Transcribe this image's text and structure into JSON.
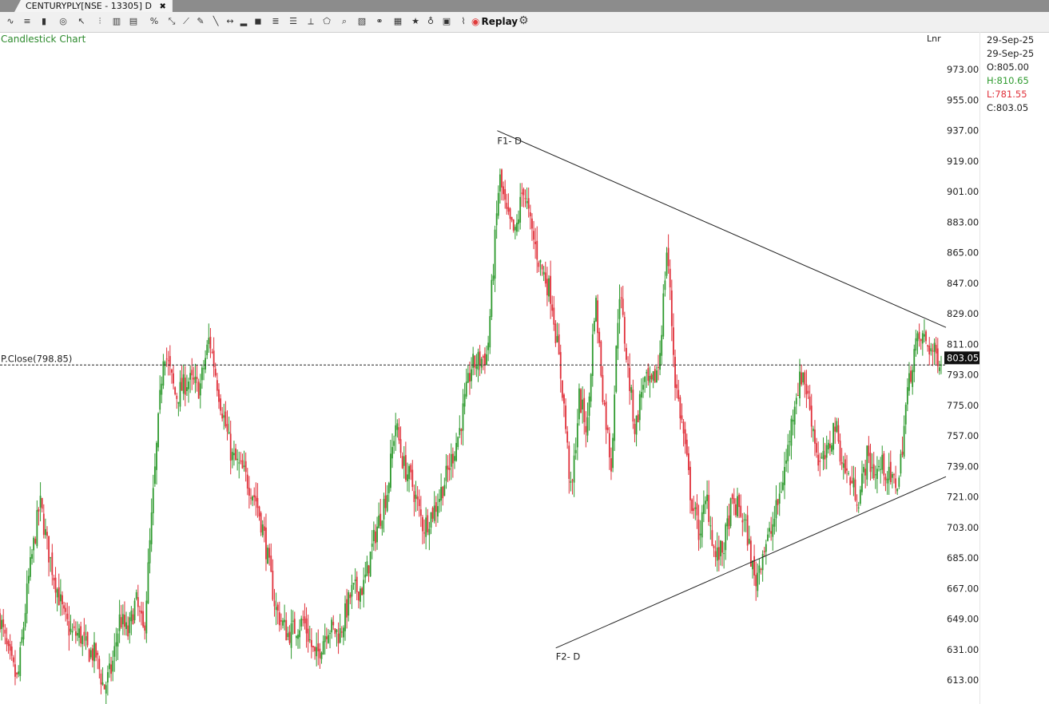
{
  "tab": {
    "title": "CENTURYPLY[NSE - 13305] D",
    "close": "✖"
  },
  "toolbar": {
    "replay_label": "Replay",
    "gear": "⚙"
  },
  "chart_title": "Candlestick Chart",
  "scale_mode": "Lnr",
  "ohlc": {
    "date1": "29-Sep-25",
    "date2": "29-Sep-25",
    "open": "O:805.00",
    "high": "H:810.65",
    "low": "L:781.55",
    "close": "C:803.05"
  },
  "colors": {
    "up": "#2e9a2e",
    "down": "#e0303a",
    "line": "#222222"
  },
  "chart_data": {
    "type": "candlestick",
    "title": "Candlestick Chart",
    "ylim": [
      600,
      988
    ],
    "y_ticks": [
      "973.00",
      "955.00",
      "937.00",
      "919.00",
      "901.00",
      "883.00",
      "865.00",
      "847.00",
      "829.00",
      "811.00",
      "793.00",
      "775.00",
      "757.00",
      "739.00",
      "721.00",
      "703.00",
      "685.00",
      "667.00",
      "649.00",
      "631.00",
      "613.00"
    ],
    "prev_close": {
      "label": "P.Close(798.85)",
      "value": 798.85
    },
    "last_price": {
      "label": "803.05",
      "value": 803.05
    },
    "trendlines": [
      {
        "from": [
          0.5264,
          937
        ],
        "to": [
          1.0,
          821
        ]
      },
      {
        "from": [
          0.5997,
          632
        ],
        "to": [
          1.0,
          733
        ]
      }
    ],
    "annotations": [
      {
        "text": "F1- D",
        "at": [
          0.5264,
          929
        ]
      },
      {
        "text": "F2- D",
        "at": [
          0.5997,
          625
        ]
      }
    ],
    "close_path": [
      [
        0.0,
        650
      ],
      [
        0.01,
        628
      ],
      [
        0.022,
        612
      ],
      [
        0.035,
        670
      ],
      [
        0.05,
        718
      ],
      [
        0.06,
        690
      ],
      [
        0.07,
        670
      ],
      [
        0.08,
        650
      ],
      [
        0.09,
        640
      ],
      [
        0.1,
        640
      ],
      [
        0.11,
        630
      ],
      [
        0.12,
        628
      ],
      [
        0.13,
        608
      ],
      [
        0.14,
        620
      ],
      [
        0.15,
        650
      ],
      [
        0.16,
        640
      ],
      [
        0.17,
        660
      ],
      [
        0.18,
        640
      ],
      [
        0.19,
        710
      ],
      [
        0.205,
        810
      ],
      [
        0.22,
        780
      ],
      [
        0.235,
        790
      ],
      [
        0.25,
        785
      ],
      [
        0.262,
        815
      ],
      [
        0.275,
        780
      ],
      [
        0.29,
        745
      ],
      [
        0.305,
        735
      ],
      [
        0.32,
        720
      ],
      [
        0.33,
        700
      ],
      [
        0.345,
        655
      ],
      [
        0.36,
        640
      ],
      [
        0.38,
        648
      ],
      [
        0.395,
        625
      ],
      [
        0.41,
        645
      ],
      [
        0.425,
        640
      ],
      [
        0.44,
        665
      ],
      [
        0.455,
        668
      ],
      [
        0.47,
        700
      ],
      [
        0.485,
        725
      ],
      [
        0.495,
        765
      ],
      [
        0.505,
        740
      ],
      [
        0.515,
        730
      ],
      [
        0.53,
        703
      ],
      [
        0.545,
        715
      ],
      [
        0.56,
        735
      ],
      [
        0.575,
        760
      ],
      [
        0.59,
        798
      ],
      [
        0.61,
        805
      ],
      [
        0.625,
        910
      ],
      [
        0.635,
        885
      ],
      [
        0.645,
        875
      ],
      [
        0.655,
        905
      ],
      [
        0.665,
        878
      ],
      [
        0.675,
        860
      ],
      [
        0.69,
        840
      ],
      [
        0.705,
        780
      ],
      [
        0.715,
        720
      ],
      [
        0.725,
        780
      ],
      [
        0.735,
        760
      ],
      [
        0.745,
        840
      ],
      [
        0.755,
        780
      ],
      [
        0.765,
        740
      ],
      [
        0.775,
        845
      ],
      [
        0.785,
        800
      ],
      [
        0.795,
        760
      ],
      [
        0.805,
        790
      ],
      [
        0.815,
        785
      ],
      [
        0.825,
        800
      ],
      [
        0.835,
        870
      ],
      [
        0.845,
        790
      ],
      [
        0.855,
        760
      ],
      [
        0.865,
        720
      ],
      [
        0.875,
        700
      ],
      [
        0.885,
        720
      ],
      [
        0.895,
        685
      ],
      [
        0.905,
        690
      ],
      [
        0.915,
        715
      ],
      [
        0.925,
        715
      ],
      [
        0.935,
        700
      ],
      [
        0.945,
        670
      ],
      [
        0.955,
        690
      ],
      [
        0.965,
        700
      ],
      [
        0.975,
        720
      ],
      [
        0.985,
        745
      ],
      [
        0.995,
        780
      ],
      [
        1.005,
        795
      ],
      [
        1.015,
        770
      ],
      [
        1.025,
        740
      ],
      [
        1.035,
        745
      ],
      [
        1.045,
        765
      ],
      [
        1.055,
        740
      ],
      [
        1.065,
        730
      ],
      [
        1.075,
        720
      ],
      [
        1.085,
        745
      ],
      [
        1.095,
        735
      ],
      [
        1.105,
        740
      ],
      [
        1.115,
        730
      ],
      [
        1.125,
        730
      ],
      [
        1.135,
        780
      ],
      [
        1.145,
        810
      ],
      [
        1.155,
        815
      ],
      [
        1.17,
        805
      ],
      [
        1.178,
        803
      ]
    ]
  }
}
